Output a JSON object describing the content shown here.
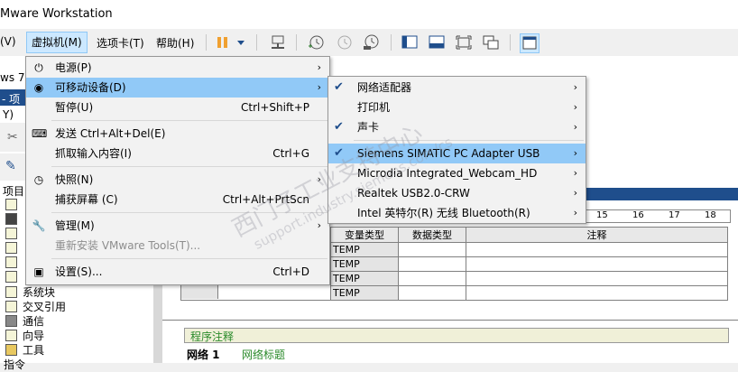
{
  "window": {
    "title": "Mware Workstation"
  },
  "menubar": {
    "items": [
      {
        "label": "(V)"
      },
      {
        "label": "虚拟机(M)"
      },
      {
        "label": "选项卡(T)"
      },
      {
        "label": "帮助(H)"
      }
    ]
  },
  "left_tree": {
    "header_fragment": "ws 7",
    "pane_title_fragment": "- 项",
    "v_fragment": "Y)",
    "project_label": "项目",
    "items": [
      "系统块",
      "交叉引用",
      "通信",
      "向导",
      "工具",
      "指令"
    ]
  },
  "vm_menu": {
    "items": [
      {
        "label": "电源(P)",
        "icon": "power-icon",
        "submenu": true
      },
      {
        "label": "可移动设备(D)",
        "icon": "cd-icon",
        "submenu": true,
        "highlighted": true
      },
      {
        "label": "暂停(U)",
        "shortcut": "Ctrl+Shift+P"
      },
      {
        "label": "发送 Ctrl+Alt+Del(E)",
        "icon": "keyboard-icon"
      },
      {
        "label": "抓取输入内容(I)",
        "shortcut": "Ctrl+G"
      },
      {
        "label": "快照(N)",
        "icon": "snapshot-icon",
        "submenu": true
      },
      {
        "label": "捕获屏幕 (C)",
        "shortcut": "Ctrl+Alt+PrtScn"
      },
      {
        "label": "管理(M)",
        "icon": "wrench-icon",
        "submenu": true
      },
      {
        "label": "重新安装 VMware Tools(T)...",
        "disabled": true
      },
      {
        "label": "设置(S)...",
        "icon": "settings-icon",
        "shortcut": "Ctrl+D"
      }
    ]
  },
  "devices_menu": {
    "items": [
      {
        "label": "网络适配器",
        "checked": true
      },
      {
        "label": "打印机",
        "checked": false
      },
      {
        "label": "声卡",
        "checked": true
      },
      {
        "label": "Siemens SIMATIC PC Adapter USB",
        "checked": true,
        "highlighted": true
      },
      {
        "label": "Microdia Integrated_Webcam_HD",
        "checked": false
      },
      {
        "label": "Realtek USB2.0-CRW",
        "checked": false
      },
      {
        "label": "Intel 英特尔(R) 无线 Bluetooth(R)",
        "checked": false
      }
    ]
  },
  "ruler": {
    "ticks": [
      "15",
      "16",
      "17",
      "18"
    ]
  },
  "var_table": {
    "headers": [
      "变量类型",
      "数据类型",
      "注释"
    ],
    "rows": [
      "TEMP",
      "TEMP",
      "TEMP",
      "TEMP"
    ]
  },
  "program": {
    "comment_label": "程序注释",
    "network_label": "网络 1",
    "network_title": "网络标题"
  },
  "watermark": {
    "text": "西门子工业支持中心",
    "url": "support.industry.siemens.com/cs"
  }
}
